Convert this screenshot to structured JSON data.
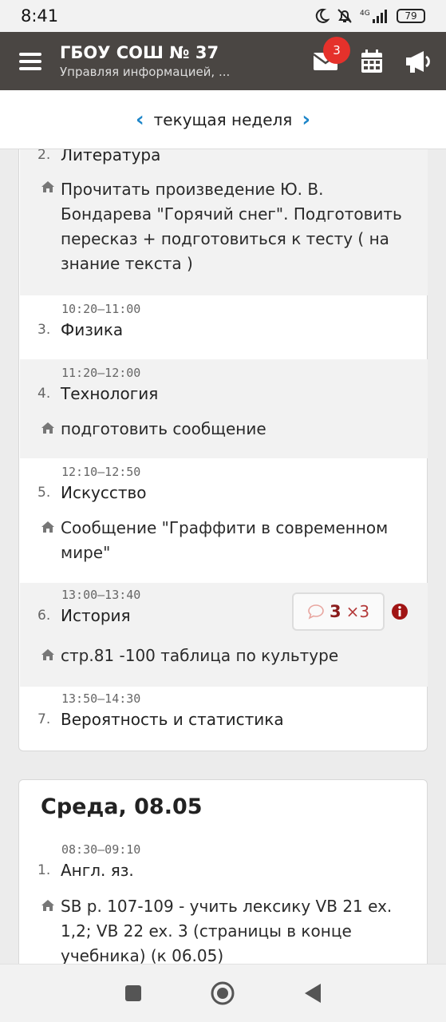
{
  "status_bar": {
    "time": "8:41",
    "battery": "79",
    "network": "4G"
  },
  "app": {
    "title": "ГБОУ СОШ № 37",
    "subtitle": "Управляя информацией, ...",
    "messages_badge": "3"
  },
  "week_nav": {
    "label": "текущая неделя"
  },
  "lessons_day1": [
    {
      "number": "2.",
      "subject": "Литература",
      "homework": "Прочитать произведение Ю. В. Бондарева \"Горячий снег\". Подготовить пересказ + подготовиться к тесту ( на знание текста )"
    },
    {
      "time": "10:20–11:00",
      "number": "3.",
      "subject": "Физика"
    },
    {
      "time": "11:20–12:00",
      "number": "4.",
      "subject": "Технология",
      "homework": "подготовить сообщение"
    },
    {
      "time": "12:10–12:50",
      "number": "5.",
      "subject": "Искусство",
      "homework": "Сообщение \"Граффити в современном мире\""
    },
    {
      "time": "13:00–13:40",
      "number": "6.",
      "subject": "История",
      "homework": "стр.81 -100 таблица по культуре",
      "grade": {
        "value": "3",
        "multiplier": "×3"
      }
    },
    {
      "time": "13:50–14:30",
      "number": "7.",
      "subject": "Вероятность и статистика"
    }
  ],
  "day2": {
    "title": "Среда, 08.05",
    "lessons": [
      {
        "time": "08:30–09:10",
        "number": "1.",
        "subject": "Англ. яз.",
        "homework": "SB p. 107-109 - учить лексику VB 21 ex. 1,2; VB 22 ex. 3 (страницы в конце учебника) (к 06.05)"
      }
    ]
  },
  "colors": {
    "appbar": "#4a4643",
    "accent": "#1e86c9",
    "badge": "#e5312b",
    "grade": "#8b1d1d"
  },
  "icons": [
    "moon-icon",
    "bell-off-icon",
    "signal-icon",
    "battery-icon",
    "menu-icon",
    "envelope-icon",
    "calendar-icon",
    "megaphone-icon",
    "home-icon",
    "comment-icon",
    "info-icon",
    "square-nav-icon",
    "circle-nav-icon",
    "back-nav-icon"
  ]
}
